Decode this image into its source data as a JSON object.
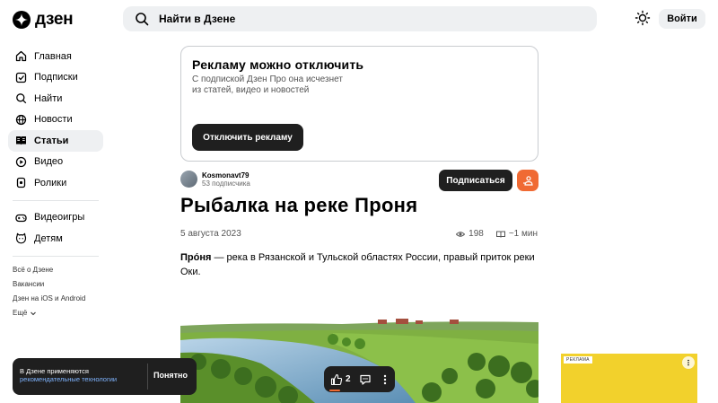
{
  "header": {
    "logo_text": "дзен",
    "search_placeholder": "Найти в Дзене",
    "login_label": "Войти"
  },
  "sidebar": {
    "items": [
      {
        "label": "Главная",
        "icon": "home-icon"
      },
      {
        "label": "Подписки",
        "icon": "subscriptions-icon"
      },
      {
        "label": "Найти",
        "icon": "search-icon"
      },
      {
        "label": "Новости",
        "icon": "globe-icon"
      },
      {
        "label": "Статьи",
        "icon": "book-icon",
        "active": true
      },
      {
        "label": "Видео",
        "icon": "video-icon"
      },
      {
        "label": "Ролики",
        "icon": "clips-icon"
      }
    ],
    "items2": [
      {
        "label": "Видеоигры",
        "icon": "gamepad-icon"
      },
      {
        "label": "Детям",
        "icon": "kids-icon"
      }
    ],
    "footer": [
      "Всё о Дзене",
      "Вакансии",
      "Дзен на iOS и Android",
      "Ещё"
    ]
  },
  "ad_banner": {
    "title": "Рекламу можно отключить",
    "subtitle": "С подпиской Дзен Про она исчезнет из статей, видео и новостей",
    "button": "Отключить рекламу"
  },
  "author": {
    "name": "Kosmonavt79",
    "subscribers": "53 подписчика",
    "subscribe_label": "Подписаться"
  },
  "article": {
    "title": "Рыбалка на реке Проня",
    "date": "5 августа 2023",
    "views": "198",
    "read_time": "~1 мин",
    "lead_bold": "Про́ня",
    "lead_rest": " — река в Рязанской и Тульской областях России, правый приток реки Оки."
  },
  "cookie": {
    "text": "В Дзене применяются",
    "link": "рекомендательные технологии",
    "button": "Понятно"
  },
  "actions": {
    "like_count": "2"
  },
  "right_ad": {
    "label": "РЕКЛАМА"
  },
  "colors": {
    "accent": "#f06a33",
    "dark": "#1f1f1f",
    "surface": "#eef0f2"
  }
}
